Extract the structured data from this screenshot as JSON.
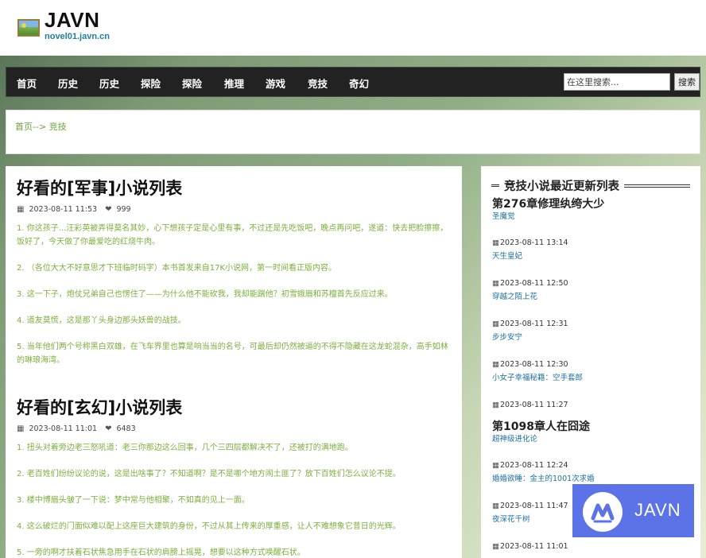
{
  "header": {
    "site_title": "JAVN",
    "site_url": "novel01.javn.cn"
  },
  "nav": {
    "items": [
      "首页",
      "历史",
      "历史",
      "探险",
      "探险",
      "推理",
      "游戏",
      "竞技",
      "奇幻"
    ],
    "search_placeholder": "在这里搜索...",
    "search_button": "搜索"
  },
  "breadcrumb": {
    "home": "首页",
    "separator": "-->",
    "current": "竞技"
  },
  "sections": [
    {
      "title": "好看的[军事]小说列表",
      "date": "2023-08-11 11:53",
      "likes": "999",
      "items": [
        "1. 你这孩子...汪彩英被弄得莫名其妙，心下想孩子定是心里有事，不过还是先吃饭吧，晚点再问吧，遂道：快去把脸擦擦，饭好了，今天做了你最爱吃的红烧牛肉。",
        "2. （各位大大不好意思才下班临时码字）本书首发来自17K小说网，第一时间看正版内容。",
        "3. 这一下子，炮仗兄弟自己也愣住了——为什么他不能砍我，我却能踹他？初雪蛾眉和苏檀首先反应过来。",
        "4. 道友莫慌，这是那丫头身边那头妖兽的战技。",
        "5. 当年他们两个号称黑白双雄，在飞车界里也算是响当当的名号，可最后却仍然被逼的不得不隐藏在这龙蛇混杂，高手如林的琳琅海湾。"
      ]
    },
    {
      "title": "好看的[玄幻]小说列表",
      "date": "2023-08-11 11:01",
      "likes": "6483",
      "items": [
        "1. 扭头对着旁边老三怒吼道：老三你那边这么回事，几个三四层都解决不了，还被打的满地跑。",
        "2. 老百姓们纷纷议论的说，这是出啥事了？不知道啊？是不是哪个地方闹土匪了？放下百姓们怎么议论不提。",
        "3. 楼中博眉头皱了一下说：梦中常与他相聚，不如真的见上一面。",
        "4. 这么破烂的门面似难以配上这座巨大建筑的身份，不过从其上传来的厚重感，让人不难想象它昔日的光辉。",
        "5. 一旁的啊才扶着石状焦急用手在石状的肩膀上摇晃，想要以这种方式唤醒石状。"
      ]
    }
  ],
  "sidebar": {
    "heading": "竞技小说最近更新列表",
    "entries": [
      {
        "big": "第276章修理纨绔大少",
        "link": "圣魔觉"
      },
      {
        "date": "2023-08-11 13:14",
        "link": "天生皇妃"
      },
      {
        "date": "2023-08-11 12:50",
        "link": "穿越之陌上花"
      },
      {
        "date": "2023-08-11 12:31",
        "link": "步步安宁"
      },
      {
        "date": "2023-08-11 12:30",
        "link": "小女子幸福秘籍：空手套郎"
      },
      {
        "date": "2023-08-11 11:27"
      },
      {
        "big": "第1098章人在囧途",
        "link": "超神级进化论"
      },
      {
        "date": "2023-08-11 12:24",
        "link": "婚婚欲睡：金主的1001次求婚"
      },
      {
        "date": "2023-08-11 11:47",
        "link": "夜深花千树"
      },
      {
        "date": "2023-08-11 11:01"
      }
    ]
  },
  "watermark": {
    "text": "JAVN"
  },
  "colors": {
    "nav_bg": "#222222",
    "item_text": "#7bb03c",
    "link": "#1e6fa0",
    "watermark_bg": "#5b73e6"
  }
}
